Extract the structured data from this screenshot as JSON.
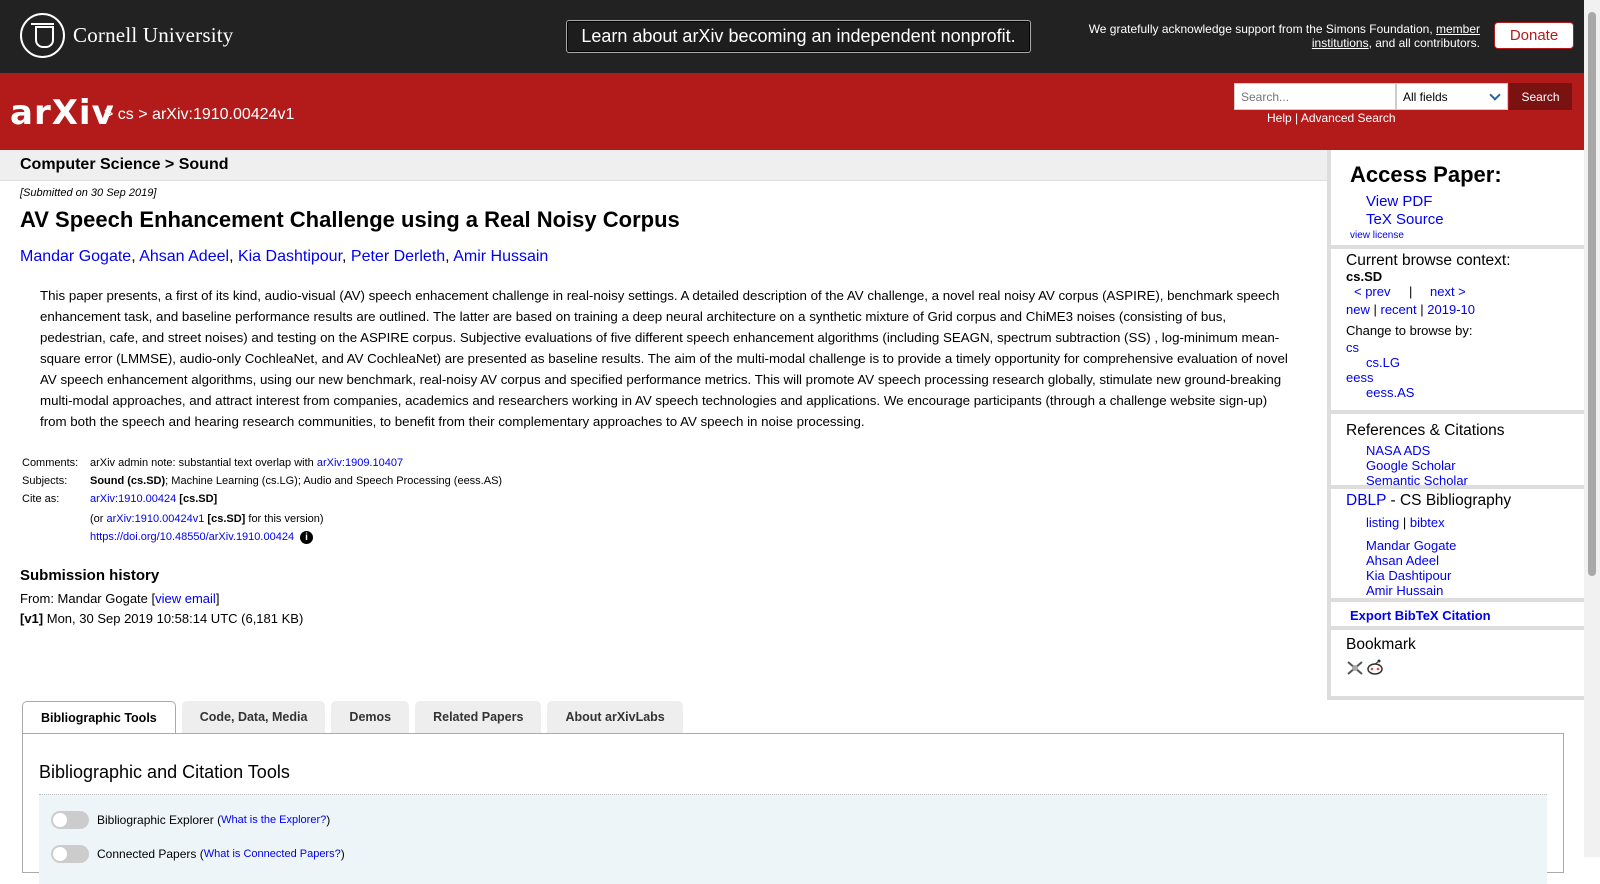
{
  "top": {
    "institution": "Cornell University",
    "banner": "Learn about arXiv becoming an independent nonprofit.",
    "support_prefix": "We gratefully acknowledge support from the Simons Foundation, ",
    "support_link": "member institutions",
    "support_suffix": ", and all contributors.",
    "donate": "Donate"
  },
  "header": {
    "logo": "arXiv",
    "sep1": ">",
    "crumb_cs": "cs",
    "sep2": ">",
    "crumb_id": "arXiv:1910.00424v1",
    "search_placeholder": "Search...",
    "field_selected": "All fields",
    "search_button": "Search",
    "help": "Help",
    "pipe": "|",
    "advanced": "Advanced Search"
  },
  "paper": {
    "subject_header": "Computer Science > Sound",
    "submitted": "[Submitted on 30 Sep 2019]",
    "title": "AV Speech Enhancement Challenge using a Real Noisy Corpus",
    "authors": [
      "Mandar Gogate",
      "Ahsan Adeel",
      "Kia Dashtipour",
      "Peter Derleth",
      "Amir Hussain"
    ],
    "abstract": "This paper presents, a first of its kind, audio-visual (AV) speech enhacement challenge in real-noisy settings. A detailed description of the AV challenge, a novel real noisy AV corpus (ASPIRE), benchmark speech enhancement task, and baseline performance results are outlined. The latter are based on training a deep neural architecture on a synthetic mixture of Grid corpus and ChiME3 noises (consisting of bus, pedestrian, cafe, and street noises) and testing on the ASPIRE corpus. Subjective evaluations of five different speech enhancement algorithms (including SEAGN, spectrum subtraction (SS) , log-minimum mean-square error (LMMSE), audio-only CochleaNet, and AV CochleaNet) are presented as baseline results. The aim of the multi-modal challenge is to provide a timely opportunity for comprehensive evaluation of novel AV speech enhancement algorithms, using our new benchmark, real-noisy AV corpus and specified performance metrics. This will promote AV speech processing research globally, stimulate new ground-breaking multi-modal approaches, and attract interest from companies, academics and researchers working in AV speech technologies and applications. We encourage participants (through a challenge website sign-up) from both the speech and hearing research communities, to benefit from their complementary approaches to AV speech in noise processing.",
    "comments_label": "Comments:",
    "comments_text": "arXiv admin note: substantial text overlap with ",
    "comments_link": "arXiv:1909.10407",
    "subjects_label": "Subjects:",
    "subjects_primary": "Sound (cs.SD)",
    "subjects_rest": "; Machine Learning (cs.LG); Audio and Speech Processing (eess.AS)",
    "cite_label": "Cite as:",
    "cite_id": "arXiv:1910.00424",
    "cite_cat": "[cs.SD]",
    "cite_or": "(or ",
    "cite_v1": "arXiv:1910.00424v1",
    "cite_cat2": "[cs.SD]",
    "cite_suffix": " for this version)",
    "doi": "https://doi.org/10.48550/arXiv.1910.00424",
    "history_title": "Submission history",
    "from_prefix": "From: Mandar Gogate [",
    "view_email": "view email",
    "from_suffix": "]",
    "v1_label": "[v1]",
    "v1_text": " Mon, 30 Sep 2019 10:58:14 UTC (6,181 KB)"
  },
  "sidebar": {
    "access_title": "Access Paper:",
    "view_pdf": "View PDF",
    "tex_source": "TeX Source",
    "view_license": "view license",
    "context_title": "Current browse context:",
    "context": "cs.SD",
    "prev": "< prev",
    "bar": "|",
    "next": "next >",
    "new": "new",
    "recent": "recent",
    "month": "2019-10",
    "change_to": "Change to browse by:",
    "cs": "cs",
    "cs_lg": "cs.LG",
    "eess": "eess",
    "eess_as": "eess.AS",
    "refs_title": "References & Citations",
    "nasa": "NASA ADS",
    "google": "Google Scholar",
    "semantic": "Semantic Scholar",
    "dblp": "DBLP",
    "dblp_suffix": " - CS Bibliography",
    "listing": "listing",
    "bibtex": "bibtex",
    "dblp_authors": [
      "Mandar Gogate",
      "Ahsan Adeel",
      "Kia Dashtipour",
      "Amir Hussain"
    ],
    "export": "Export BibTeX Citation",
    "bookmark": "Bookmark"
  },
  "tabs": [
    "Bibliographic Tools",
    "Code, Data, Media",
    "Demos",
    "Related Papers",
    "About arXivLabs"
  ],
  "panel": {
    "title": "Bibliographic and Citation Tools",
    "tool1": "Bibliographic Explorer",
    "tool1_link": "What is the Explorer?",
    "tool2": "Connected Papers",
    "tool2_link": "What is Connected Papers?"
  }
}
